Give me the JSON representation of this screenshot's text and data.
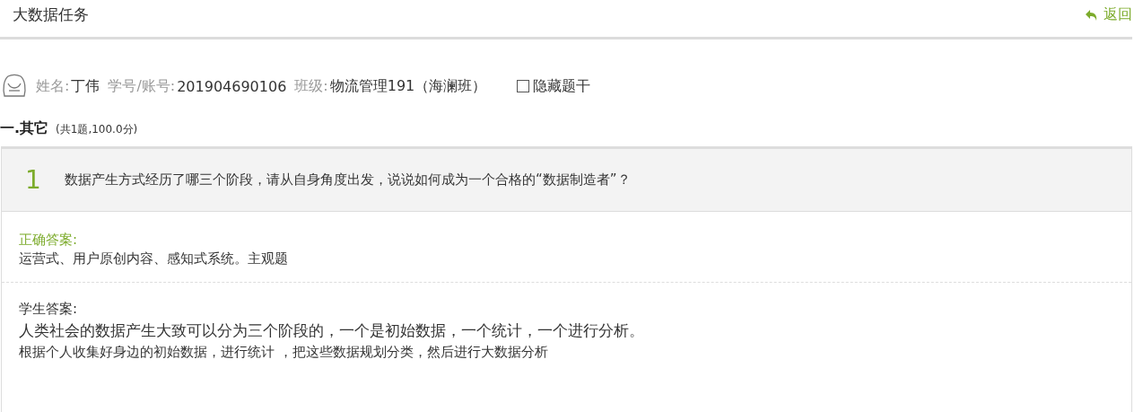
{
  "header": {
    "title": "大数据任务",
    "back_link": "返回"
  },
  "student": {
    "fields": [
      {
        "label": "姓名:",
        "value": "丁伟"
      },
      {
        "label": "学号/账号:",
        "value": "201904690106"
      },
      {
        "label": "班级:",
        "value": "物流管理191（海澜班）"
      }
    ],
    "hide_stem": {
      "label": "隐藏题干",
      "checked": false
    }
  },
  "section": {
    "title": "一.其它",
    "summary": "(共1题,100.0分)"
  },
  "question": {
    "number": "1",
    "text": "数据产生方式经历了哪三个阶段，请从自身角度出发，说说如何成为一个合格的“数据制造者”？",
    "correct_answer": {
      "label": "正确答案:",
      "text": "运营式、用户原创内容、感知式系统。主观题"
    },
    "student_answer": {
      "label": "学生答案:",
      "lines": [
        "人类社会的数据产生大致可以分为三个阶段的，一个是初始数据，一个统计，一个进行分析。",
        "根据个人收集好身边的初始数据，进行统计 ，把这些数据规划分类，然后进行大数据分析"
      ]
    }
  }
}
